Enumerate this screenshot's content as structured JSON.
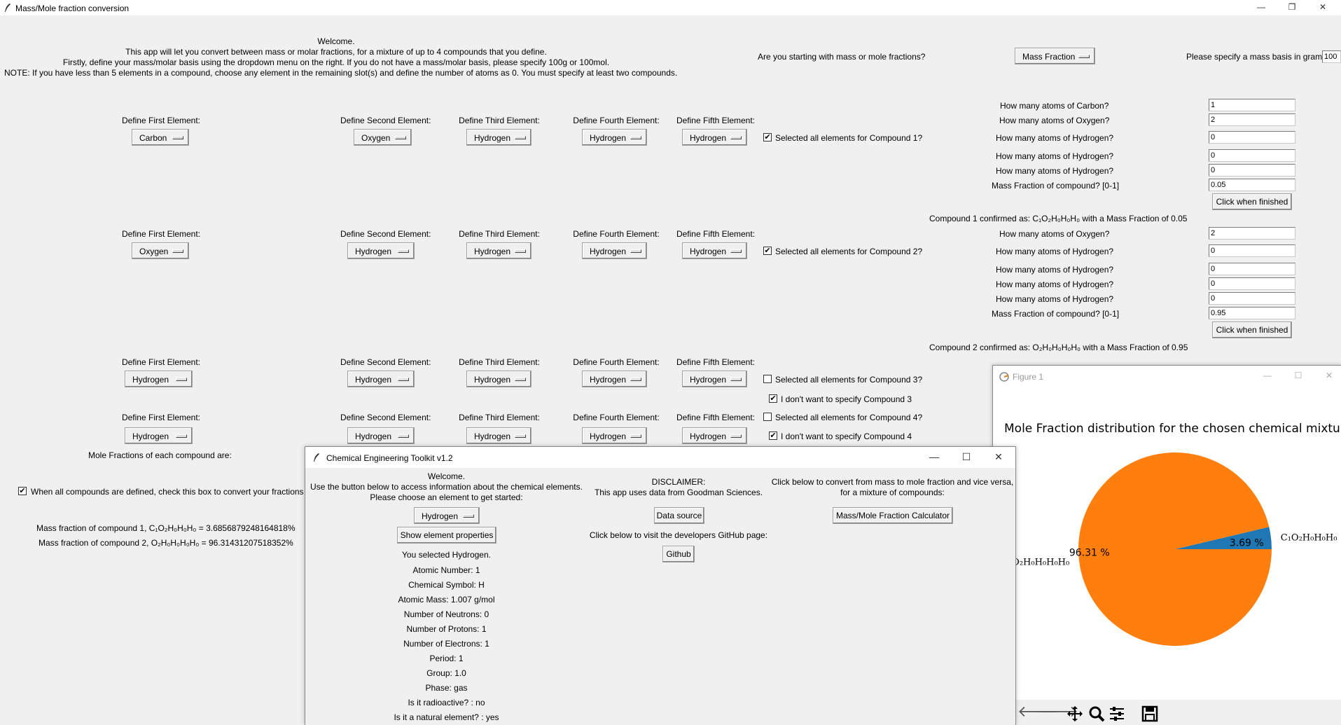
{
  "main": {
    "window_title": "Mass/Mole fraction conversion",
    "welcome_lines": [
      "Welcome.",
      "This app will let you convert between mass or molar fractions, for a mixture of up to 4 compounds that you define.",
      "Firstly, define your mass/molar basis using the dropdown menu on the right. If you do not have a mass/molar basis, please specify 100g or 100mol.",
      "NOTE: If you have less than 5 elements in a compound, choose any element in the remaining slot(s) and define the number of atoms as 0. You must specify at least two compounds."
    ],
    "question_mass_or_mole": "Are you starting with mass or mole fractions?",
    "fraction_type": "Mass Fraction",
    "basis_label": "Please specify a mass basis in grams",
    "basis_value": "100",
    "element_labels": [
      "Define First Element:",
      "Define Second Element:",
      "Define Third Element:",
      "Define Fourth Element:",
      "Define Fifth Element:"
    ],
    "compounds": [
      {
        "elements": [
          "Carbon",
          "Oxygen",
          "Hydrogen",
          "Hydrogen",
          "Hydrogen"
        ],
        "selected_label": "Selected all elements for Compound 1?",
        "selected": true
      },
      {
        "elements": [
          "Oxygen",
          "Hydrogen",
          "Hydrogen",
          "Hydrogen",
          "Hydrogen"
        ],
        "selected_label": "Selected all elements for Compound 2?",
        "selected": true
      },
      {
        "elements": [
          "Hydrogen",
          "Hydrogen",
          "Hydrogen",
          "Hydrogen",
          "Hydrogen"
        ],
        "selected_label": "Selected all elements for Compound 3?",
        "selected": false,
        "skip_label": "I don't want to specify Compound 3",
        "skip": true
      },
      {
        "elements": [
          "Hydrogen",
          "Hydrogen",
          "Hydrogen",
          "Hydrogen",
          "Hydrogen"
        ],
        "selected_label": "Selected all elements for Compound 4?",
        "selected": false,
        "skip_label": "I don't want to specify Compound 4",
        "skip": true
      }
    ],
    "atoms1": {
      "labels": [
        "How many atoms of Carbon?",
        "How many atoms of Oxygen?",
        "How many atoms of Hydrogen?",
        "How many atoms of Hydrogen?",
        "How many atoms of Hydrogen?",
        "Mass Fraction of compound? [0-1]"
      ],
      "values": [
        "1",
        "2",
        "0",
        "0",
        "0",
        "0.05"
      ],
      "button": "Click when finished",
      "confirm": "Compound 1 confirmed as: C₁O₂H₀H₀H₀ with a Mass Fraction of 0.05"
    },
    "atoms2": {
      "labels": [
        "How many atoms of Oxygen?",
        "How many atoms of Hydrogen?",
        "How many atoms of Hydrogen?",
        "How many atoms of Hydrogen?",
        "How many atoms of Hydrogen?",
        "Mass Fraction of compound? [0-1]"
      ],
      "values": [
        "2",
        "0",
        "0",
        "0",
        "0",
        "0.95"
      ],
      "button": "Click when finished",
      "confirm": "Compound 2 confirmed as: O₂H₀H₀H₀H₀ with a Mass Fraction of 0.95"
    },
    "mole_fractions_label": "Mole Fractions of each compound are:",
    "convert_check_label": "When all compounds are defined, check this box to convert your fractions",
    "convert_checked": true,
    "results": [
      "Mass fraction of compound 1, C₁O₂H₀H₀H₀ = 3.6856879248164818%",
      "Mass fraction of compound 2, O₂H₀H₀H₀H₀ = 96.31431207518352%"
    ]
  },
  "toolkit": {
    "title": "Chemical Engineering Toolkit v1.2",
    "intro_lines": [
      "Welcome.",
      "Use the button below to access information about the chemical elements.",
      "Please choose an element to get started:"
    ],
    "element": "Hydrogen",
    "show_button": "Show element properties",
    "selected_text": "You selected Hydrogen.",
    "properties": [
      "Atomic Number: 1",
      "Chemical Symbol: H",
      "Atomic Mass: 1.007 g/mol",
      "Number of Neutrons: 0",
      "Number of Protons: 1",
      "Number of Electrons: 1",
      "Period: 1",
      "Group: 1.0",
      "Phase: gas",
      "Is it radioactive? : no",
      "Is it a natural element? : yes"
    ],
    "disclaimer_lines": [
      "DISCLAIMER:",
      "This app uses data from Goodman Sciences."
    ],
    "data_source_button": "Data source",
    "github_text": "Click below to visit the developers GitHub page:",
    "github_button": "Github",
    "convert_lines": [
      "Click below to convert from mass to mole fraction and vice versa,",
      "for a mixture of compounds:"
    ],
    "calculator_button": "Mass/Mole Fraction Calculator"
  },
  "figure": {
    "window_title": "Figure 1",
    "chart_data": {
      "type": "pie",
      "title": "Mole Fraction distribution for the chosen chemical mixture",
      "labels": [
        "C₁O₂H₀H₀H₀",
        "O₂H₀H₀H₀H₀"
      ],
      "values": [
        3.69,
        96.31
      ],
      "pct_labels": [
        "3.69 %",
        "96.31 %"
      ],
      "colors": [
        "#1f77b4",
        "#ff7f0e"
      ]
    }
  }
}
